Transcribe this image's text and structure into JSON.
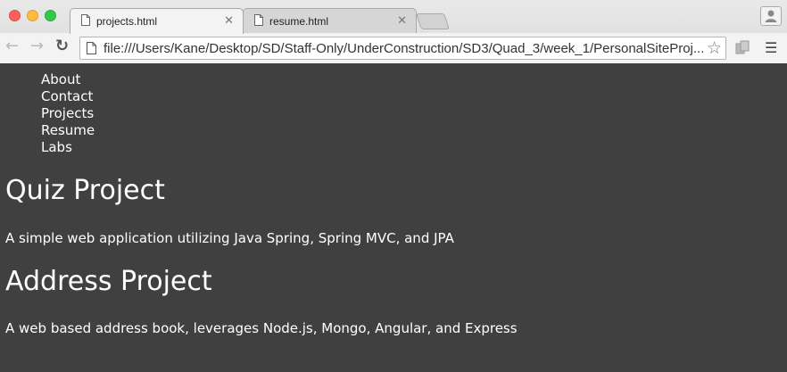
{
  "browser": {
    "tabs": [
      {
        "title": "projects.html",
        "active": true
      },
      {
        "title": "resume.html",
        "active": false
      }
    ],
    "url": "file:///Users/Kane/Desktop/SD/Staff-Only/UnderConstruction/SD3/Quad_3/week_1/PersonalSiteProj..."
  },
  "nav": {
    "items": [
      "About",
      "Contact",
      "Projects",
      "Resume",
      "Labs"
    ]
  },
  "projects": [
    {
      "title": "Quiz Project",
      "description": "A simple web application utilizing Java Spring, Spring MVC, and JPA"
    },
    {
      "title": "Address Project",
      "description": "A web based address book, leverages Node.js, Mongo, Angular, and Express"
    }
  ],
  "colors": {
    "page_background": "#404040",
    "page_text": "#ffffff"
  }
}
